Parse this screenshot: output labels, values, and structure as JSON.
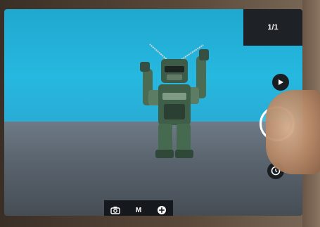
{
  "viewer": {
    "counter": "1/1"
  },
  "controls": {
    "play_icon": "play-icon",
    "shutter_icon": "shutter-button",
    "timer_icon": "clock-icon"
  },
  "mode_bar": {
    "items": [
      {
        "icon": "camera-icon",
        "label": "",
        "active": true
      },
      {
        "icon": "",
        "label": "M",
        "active": false
      },
      {
        "icon": "add-circle-icon",
        "label": "",
        "active": false
      }
    ]
  },
  "colors": {
    "accent": "#2f8ff0",
    "sky": "#26b8e0",
    "panel": "#1e2226"
  }
}
